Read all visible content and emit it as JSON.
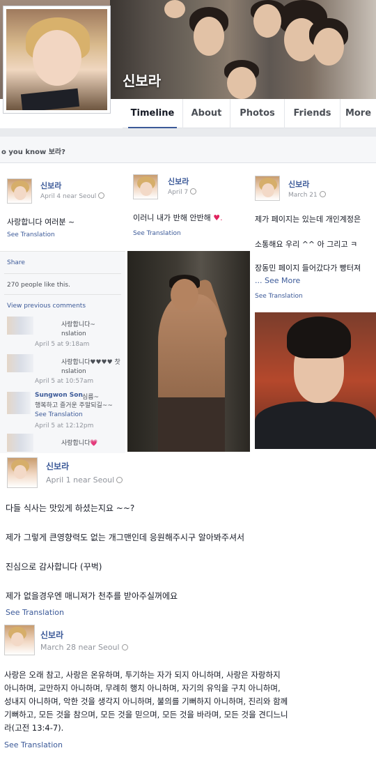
{
  "profile": {
    "name": "신보라"
  },
  "tabs": [
    {
      "label": "Timeline",
      "active": true
    },
    {
      "label": "About",
      "active": false
    },
    {
      "label": "Photos",
      "active": false
    },
    {
      "label": "Friends",
      "active": false
    },
    {
      "label": "More",
      "active": false
    }
  ],
  "dyk": "o you know 보라?",
  "cards": [
    {
      "name": "신보라",
      "meta": "April 4 near Seoul",
      "text": "사랑합니다 여러분 ~",
      "see_translation": "See Translation",
      "share": "Share",
      "likes": "270 people like this.",
      "view_prev": "View previous comments",
      "comments": [
        {
          "text": "사랑합니다~",
          "sub": "nslation",
          "time": "April 5 at 9:18am"
        },
        {
          "text": "사랑합니다♥♥♥♥ 찻",
          "sub": "nslation",
          "time": "April 5 at 10:57am"
        },
        {
          "author": "Sungwon Son",
          "text": "심름~",
          "line2": "행복하고 즐거운 주말되길~~",
          "sub": "See Translation",
          "time": "April 5 at 12:12pm"
        },
        {
          "text": "사랑합니다",
          "heart": "💗"
        }
      ]
    },
    {
      "name": "신보라",
      "meta": "April 7",
      "text": "이러니 내가 반해 안반해",
      "heart": "♥.",
      "see_translation": "See Translation"
    },
    {
      "name": "신보라",
      "meta": "March 21",
      "lines": [
        "제가 페이지는 있는데 개인계정은",
        "소통해요 우리 ^^ 아 그리고 ㅋ",
        "장동민 페이지 들어갔다가 빵터져"
      ],
      "see_more": "... See More",
      "see_translation": "See Translation"
    }
  ],
  "posts": [
    {
      "name": "신보라",
      "meta": "April 1 near Seoul",
      "lines": [
        "다들 식사는 맛있게 하셨는지요 ~~?",
        "제가 그렇게 큰영향력도 없는 개그맨인데 응원해주시구 알아봐주셔서",
        "진심으로 감사합니다 (꾸벅)",
        "제가 없을경우엔 매니져가 천추를 받아주실꺼에요"
      ],
      "see_translation": "See Translation"
    },
    {
      "name": "신보라",
      "meta": "March 28 near Seoul",
      "lines": [
        "사랑은 오래 참고, 사랑은 온유하며, 투기하는 자가 되지 아니하며, 사랑은 자랑하지",
        "아니하며, 교만하지 아니하며, 무례히 행치 아니하며, 자기의 유익을 구치 아니하며,",
        "성내지 아니하며, 악한 것을 생각지 아니하며, 불의를 기뻐하지 아니하며, 진리와 함께",
        "기뻐하고, 모든 것을 참으며, 모든 것을 믿으며, 모든 것을 바라며, 모든 것을 견디느니",
        "라(고전 13:4-7)."
      ],
      "see_translation": "See Translation"
    }
  ]
}
